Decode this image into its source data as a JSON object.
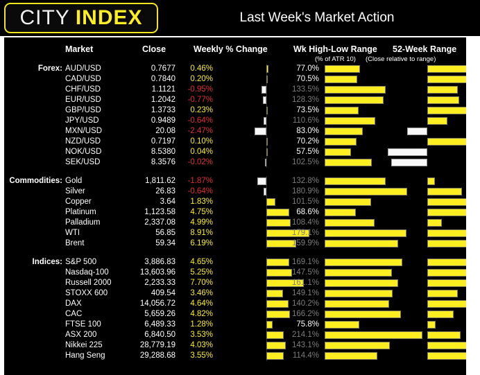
{
  "header": {
    "logo_primary": "CITY",
    "logo_secondary": "INDEX",
    "title": "Last Week's Market Action",
    "accent_color": "#fdee21",
    "background_color": "#000000"
  },
  "columns": {
    "market": "Market",
    "close": "Close",
    "weekly_change": "Weekly % Change",
    "wk_high_low": "Wk High-Low Range",
    "wk_high_low_sub": "(% of ATR 10)",
    "week52": "52-Week Range",
    "week52_sub": "(Close relative to range)"
  },
  "groups": [
    {
      "label": "Forex:",
      "rows": [
        {
          "name": "AUD/USD",
          "close": "0.7677",
          "pct": "0.46%",
          "pct_value": 0.46,
          "atr": "77.0%",
          "atr_value": 77.0,
          "rel52": 66
        },
        {
          "name": "CAD/USD",
          "close": "0.7840",
          "pct": "0.20%",
          "pct_value": 0.2,
          "atr": "70.5%",
          "atr_value": 70.5,
          "rel52": 64
        },
        {
          "name": "CHF/USD",
          "close": "1.1121",
          "pct": "-0.95%",
          "pct_value": -0.95,
          "atr": "133.5%",
          "atr_value": 133.5,
          "rel52": 46
        },
        {
          "name": "EUR/USD",
          "close": "1.2042",
          "pct": "-0.77%",
          "pct_value": -0.77,
          "atr": "128.3%",
          "atr_value": 128.3,
          "rel52": 48
        },
        {
          "name": "GBP/USD",
          "close": "1.3733",
          "pct": "0.23%",
          "pct_value": 0.23,
          "atr": "73.5%",
          "atr_value": 73.5,
          "rel52": 68
        },
        {
          "name": "JPY/USD",
          "close": "0.9489",
          "pct": "-0.64%",
          "pct_value": -0.64,
          "atr": "110.6%",
          "atr_value": 110.6,
          "rel52": 30
        },
        {
          "name": "MXN/USD",
          "close": "20.08",
          "pct": "-2.47%",
          "pct_value": -2.47,
          "atr": "83.0%",
          "atr_value": 83.0,
          "rel52": -31
        },
        {
          "name": "NZD/USD",
          "close": "0.7197",
          "pct": "0.10%",
          "pct_value": 0.1,
          "atr": "70.2%",
          "atr_value": 70.2,
          "rel52": 62
        },
        {
          "name": "NOK/USD",
          "close": "8.5380",
          "pct": "0.04%",
          "pct_value": 0.04,
          "atr": "57.5%",
          "atr_value": 57.5,
          "rel52": -60
        },
        {
          "name": "SEK/USD",
          "close": "8.3576",
          "pct": "-0.02%",
          "pct_value": -0.02,
          "atr": "102.5%",
          "atr_value": 102.5,
          "rel52": -55
        }
      ]
    },
    {
      "label": "Commodities:",
      "rows": [
        {
          "name": "Gold",
          "close": "1,811.62",
          "pct": "-1.87%",
          "pct_value": -1.87,
          "atr": "132.8%",
          "atr_value": 132.8,
          "rel52": 12
        },
        {
          "name": "Silver",
          "close": "26.83",
          "pct": "-0.64%",
          "pct_value": -0.64,
          "atr": "180.9%",
          "atr_value": 180.9,
          "rel52": 53
        },
        {
          "name": "Copper",
          "close": "3.64",
          "pct": "1.83%",
          "pct_value": 1.83,
          "atr": "101.5%",
          "atr_value": 101.5,
          "rel52": 62
        },
        {
          "name": "Platinum",
          "close": "1,123.58",
          "pct": "4.75%",
          "pct_value": 4.75,
          "atr": "68.6%",
          "atr_value": 68.6,
          "rel52": 65
        },
        {
          "name": "Palladium",
          "close": "2,337.08",
          "pct": "4.99%",
          "pct_value": 4.99,
          "atr": "108.4%",
          "atr_value": 108.4,
          "rel52": 22
        },
        {
          "name": "WTI",
          "close": "56.85",
          "pct": "8.91%",
          "pct_value": 8.91,
          "atr": "179.1%",
          "atr_value": 179.1,
          "rel52": 66
        },
        {
          "name": "Brent",
          "close": "59.34",
          "pct": "6.19%",
          "pct_value": 6.19,
          "atr": "159.9%",
          "atr_value": 159.9,
          "rel52": 64
        }
      ]
    },
    {
      "label": "Indices:",
      "rows": [
        {
          "name": "S&P 500",
          "close": "3,886.83",
          "pct": "4.65%",
          "pct_value": 4.65,
          "atr": "169.1%",
          "atr_value": 169.1,
          "rel52": 65
        },
        {
          "name": "Nasdaq-100",
          "close": "13,603.96",
          "pct": "5.25%",
          "pct_value": 5.25,
          "atr": "147.5%",
          "atr_value": 147.5,
          "rel52": 65
        },
        {
          "name": "Russell 2000",
          "close": "2,233.33",
          "pct": "7.70%",
          "pct_value": 7.7,
          "atr": "161.1%",
          "atr_value": 161.1,
          "rel52": 65
        },
        {
          "name": "STOXX 600",
          "close": "409.54",
          "pct": "3.46%",
          "pct_value": 3.46,
          "atr": "149.1%",
          "atr_value": 149.1,
          "rel52": 46
        },
        {
          "name": "DAX",
          "close": "14,056.72",
          "pct": "4.64%",
          "pct_value": 4.64,
          "atr": "140.2%",
          "atr_value": 140.2,
          "rel52": 65
        },
        {
          "name": "CAC",
          "close": "5,659.26",
          "pct": "4.82%",
          "pct_value": 4.82,
          "atr": "166.2%",
          "atr_value": 166.2,
          "rel52": 40
        },
        {
          "name": "FTSE 100",
          "close": "6,489.33",
          "pct": "1.28%",
          "pct_value": 1.28,
          "atr": "75.8%",
          "atr_value": 75.8,
          "rel52": 13
        },
        {
          "name": "ASX 200",
          "close": "6,840.50",
          "pct": "3.53%",
          "pct_value": 3.53,
          "atr": "214.1%",
          "atr_value": 214.1,
          "rel52": 50
        },
        {
          "name": "Nikkei 225",
          "close": "28,779.19",
          "pct": "4.03%",
          "pct_value": 4.03,
          "atr": "143.1%",
          "atr_value": 143.1,
          "rel52": 65
        },
        {
          "name": "Hang Seng",
          "close": "29,288.68",
          "pct": "3.55%",
          "pct_value": 3.55,
          "atr": "114.4%",
          "atr_value": 114.4,
          "rel52": 62
        }
      ]
    }
  ],
  "chart_data": {
    "type": "bar",
    "title": "Last Week's Market Action",
    "subtitle": "",
    "xlabel": "",
    "ylabel": "",
    "grid": false,
    "legend_position": "none",
    "categories": [
      "AUD/USD",
      "CAD/USD",
      "CHF/USD",
      "EUR/USD",
      "GBP/USD",
      "JPY/USD",
      "MXN/USD",
      "NZD/USD",
      "NOK/USD",
      "SEK/USD",
      "Gold",
      "Silver",
      "Copper",
      "Platinum",
      "Palladium",
      "WTI",
      "Brent",
      "S&P 500",
      "Nasdaq-100",
      "Russell 2000",
      "STOXX 600",
      "DAX",
      "CAC",
      "FTSE 100",
      "ASX 200",
      "Nikkei 225",
      "Hang Seng"
    ],
    "series": [
      {
        "name": "Weekly % Change",
        "unit": "%",
        "values": [
          0.46,
          0.2,
          -0.95,
          -0.77,
          0.23,
          -0.64,
          -2.47,
          0.1,
          0.04,
          -0.02,
          -1.87,
          -0.64,
          1.83,
          4.75,
          4.99,
          8.91,
          6.19,
          4.65,
          5.25,
          7.7,
          3.46,
          4.64,
          4.82,
          1.28,
          3.53,
          4.03,
          3.55
        ]
      },
      {
        "name": "Wk High-Low Range (% of ATR 10)",
        "unit": "%",
        "values": [
          77.0,
          70.5,
          133.5,
          128.3,
          73.5,
          110.6,
          83.0,
          70.2,
          57.5,
          102.5,
          132.8,
          180.9,
          101.5,
          68.6,
          108.4,
          179.1,
          159.9,
          169.1,
          147.5,
          161.1,
          149.1,
          140.2,
          166.2,
          75.8,
          214.1,
          143.1,
          114.4
        ]
      },
      {
        "name": "52-Week Range (Close relative to range)",
        "unit": "index",
        "values": [
          66,
          64,
          46,
          48,
          68,
          30,
          -31,
          62,
          -60,
          -55,
          12,
          53,
          62,
          65,
          22,
          66,
          64,
          65,
          65,
          65,
          46,
          65,
          40,
          13,
          50,
          65,
          62
        ]
      }
    ],
    "close_values": [
      0.7677,
      0.784,
      1.1121,
      1.2042,
      1.3733,
      0.9489,
      20.08,
      0.7197,
      8.538,
      8.3576,
      1811.62,
      26.83,
      3.64,
      1123.58,
      2337.08,
      56.85,
      59.34,
      3886.83,
      13603.96,
      2233.33,
      409.54,
      14056.72,
      5659.26,
      6489.33,
      6840.5,
      28779.19,
      29288.68
    ],
    "colors": {
      "positive": "#fdee21",
      "negative": "#f8f8f8",
      "negative_text": "#e03030",
      "positive_text": "#fdee21"
    }
  }
}
